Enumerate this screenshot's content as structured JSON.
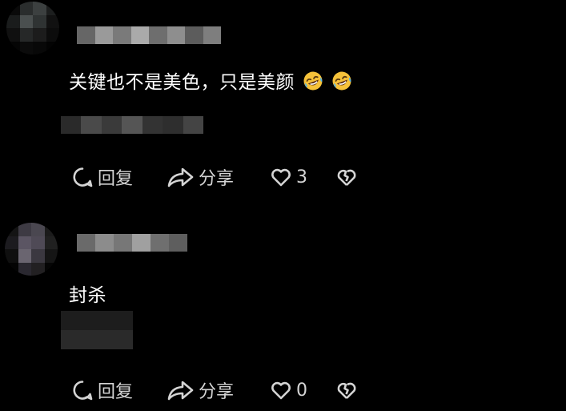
{
  "comments": [
    {
      "avatar_colors": [
        "#0a0a0a",
        "#2a2d2d",
        "#3c4040",
        "#1c1e1e",
        "#1a1c1c",
        "#4a4f4f",
        "#2f3333",
        "#111111",
        "#101010",
        "#262828",
        "#1c1c1c",
        "#0c0c0c",
        "#050505",
        "#0b0b0b",
        "#080808",
        "#030303"
      ],
      "username_blur_colors": [
        "#666666",
        "#9a9a9a",
        "#7a7a7a",
        "#aaaaaa",
        "#6e6e6e",
        "#8e8e8e",
        "#5c5c5c",
        "#7e7e7e"
      ],
      "text": "关键也不是美色，只是美颜",
      "emojis": [
        "rolling-on-floor-laughing",
        "rolling-on-floor-laughing"
      ],
      "meta_blur_colors": [
        "#2a2a2a",
        "#4a4a4a",
        "#3a3a3a",
        "#555555",
        "#333333",
        "#2e2e2e",
        "#444444"
      ],
      "actions": {
        "reply_label": "回复",
        "share_label": "分享",
        "like_count": "3"
      }
    },
    {
      "avatar_colors": [
        "#141414",
        "#3d3a43",
        "#4a4750",
        "#1b1b1b",
        "#1c1b1f",
        "#5b5563",
        "#4f4a56",
        "#202020",
        "#0f0f0f",
        "#6a6570",
        "#3b3840",
        "#151515",
        "#040404",
        "#2a2830",
        "#222022",
        "#050505"
      ],
      "username_blur_colors": [
        "#6a6a6a",
        "#8c8c8c",
        "#777777",
        "#a0a0a0",
        "#6f6f6f",
        "#5e5e5e"
      ],
      "text": "封杀",
      "emojis": [],
      "meta_blur_colors": [
        "#1d1d1d",
        "#2a2a2a"
      ],
      "actions": {
        "reply_label": "回复",
        "share_label": "分享",
        "like_count": "0"
      }
    }
  ]
}
